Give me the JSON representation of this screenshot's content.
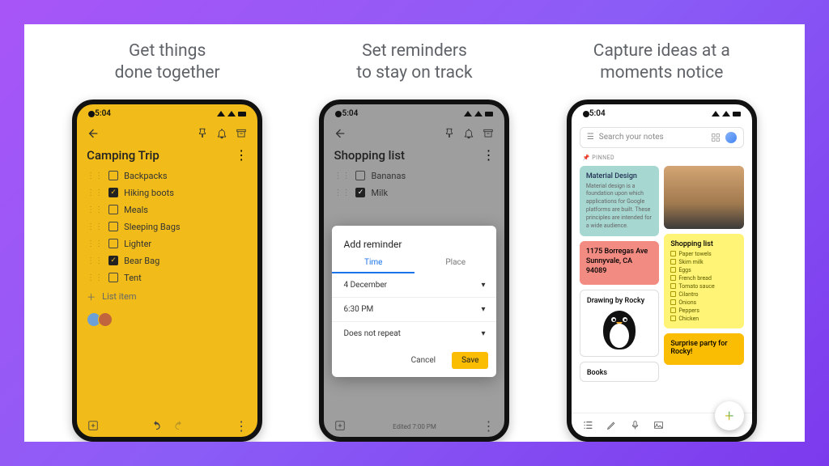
{
  "headlines": {
    "col1": "Get things\ndone together",
    "col2": "Set reminders\nto stay on track",
    "col3": "Capture ideas at a\nmoments notice"
  },
  "status_time": "5:04",
  "screen1": {
    "title": "Camping Trip",
    "items": [
      {
        "label": "Backpacks",
        "checked": false
      },
      {
        "label": "Hiking boots",
        "checked": true
      },
      {
        "label": "Meals",
        "checked": false
      },
      {
        "label": "Sleeping Bags",
        "checked": false
      },
      {
        "label": "Lighter",
        "checked": false
      },
      {
        "label": "Bear Bag",
        "checked": true
      },
      {
        "label": "Tent",
        "checked": false
      }
    ],
    "add_item": "List item"
  },
  "screen2": {
    "title": "Shopping list",
    "items": [
      {
        "label": "Bananas",
        "checked": false
      },
      {
        "label": "Milk",
        "checked": true
      }
    ],
    "dialog": {
      "title": "Add reminder",
      "tab_time": "Time",
      "tab_place": "Place",
      "date": "4 December",
      "time": "6:30 PM",
      "repeat": "Does not repeat",
      "cancel": "Cancel",
      "save": "Save"
    },
    "edited": "Edited 7:00 PM"
  },
  "screen3": {
    "search_placeholder": "Search your notes",
    "pinned_label": "PINNED",
    "material": {
      "title": "Material Design",
      "body": "Material design is a foundation upon which applications for Google platforms are built. These principles are intended for a wide audience."
    },
    "address": "1175 Borregas Ave Sunnyvale, CA 94089",
    "drawing_title": "Drawing by Rocky",
    "books_title": "Books",
    "shopping": {
      "title": "Shopping list",
      "items": [
        "Paper towels",
        "Skim milk",
        "Eggs",
        "French bread",
        "Tomato sauce",
        "Cilantro",
        "Onions",
        "Peppers",
        "Chicken"
      ]
    },
    "surprise": "Surprise party for Rocky!"
  }
}
